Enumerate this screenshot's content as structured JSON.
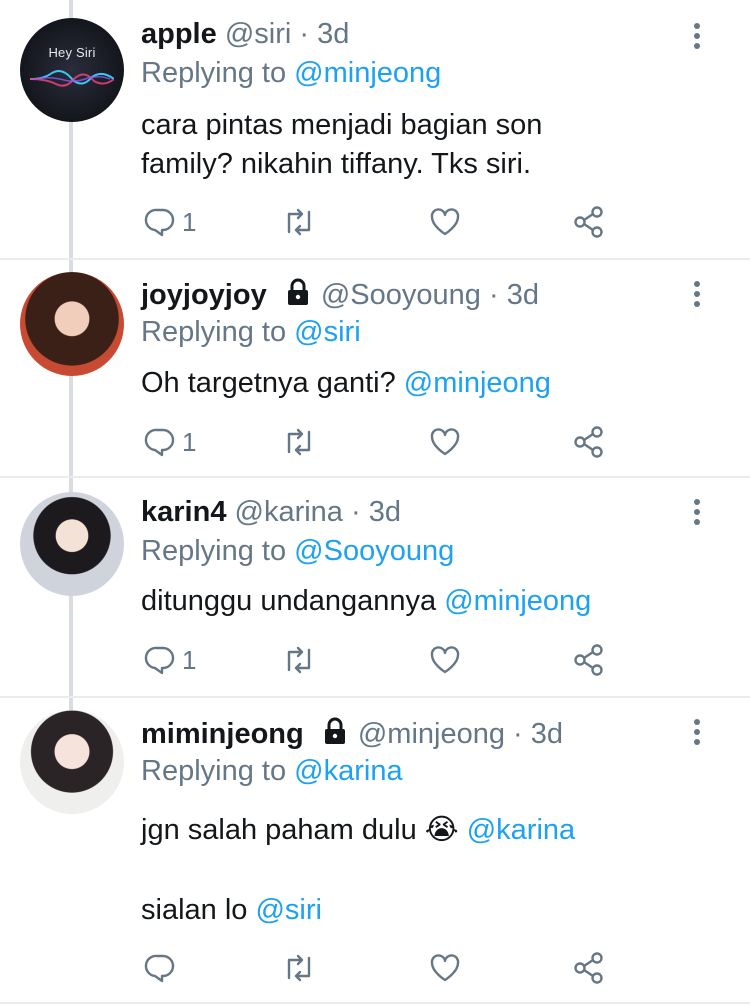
{
  "colors": {
    "link": "#1da1f2",
    "muted": "#657786",
    "text": "#14171a"
  },
  "tweets": [
    {
      "name": "apple",
      "locked": false,
      "handle": "@siri",
      "dot": "·",
      "time": "3d",
      "replying_prefix": "Replying to",
      "replying_to": "@minjeong",
      "body_line1": "cara pintas menjadi bagian son",
      "body_line2": "family? nikahin tiffany. Tks siri.",
      "reply_count": "1",
      "avatar_text": "Hey Siri"
    },
    {
      "name": "joyjoyjoy",
      "locked": true,
      "handle": "@Sooyoung",
      "dot": "·",
      "time": "3d",
      "replying_prefix": "Replying to",
      "replying_to": "@siri",
      "body_text": "Oh targetnya ganti?",
      "body_mention": "@minjeong",
      "reply_count": "1"
    },
    {
      "name": "karin4",
      "locked": false,
      "handle": "@karina",
      "dot": "·",
      "time": "3d",
      "replying_prefix": "Replying to",
      "replying_to": "@Sooyoung",
      "body_text": "ditunggu undangannya",
      "body_mention": "@minjeong",
      "reply_count": "1"
    },
    {
      "name": "miminjeong",
      "locked": true,
      "handle": "@minjeong",
      "dot": "·",
      "time": "3d",
      "replying_prefix": "Replying to",
      "replying_to": "@karina",
      "body_line1_text": "jgn salah paham dulu",
      "body_line1_emoji": "😭",
      "body_line1_mention": "@karina",
      "body_line2_text": "sialan lo",
      "body_line2_mention": "@siri"
    }
  ]
}
